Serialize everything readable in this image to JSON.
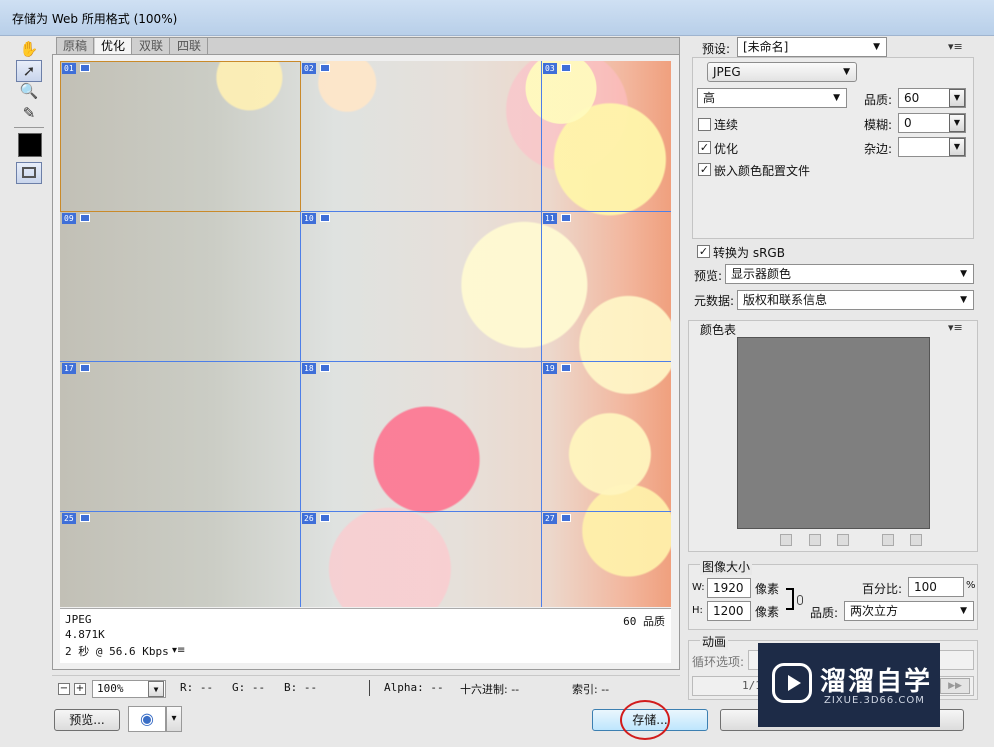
{
  "window": {
    "title": "存储为 Web 所用格式 (100%)"
  },
  "tools": [
    {
      "name": "hand-tool-icon",
      "glyph": "✋"
    },
    {
      "name": "slice-select-tool-icon",
      "glyph": "➚"
    },
    {
      "name": "zoom-tool-icon",
      "glyph": "🔍"
    },
    {
      "name": "eyedropper-tool-icon",
      "glyph": "✎"
    }
  ],
  "tabs": [
    "原稿",
    "优化",
    "双联",
    "四联"
  ],
  "active_tab": "优化",
  "slices": [
    "01",
    "02",
    "03",
    "09",
    "10",
    "11",
    "17",
    "18",
    "19",
    "25",
    "26",
    "27"
  ],
  "image_info": {
    "format": "JPEG",
    "size": "4.871K",
    "time": "2 秒 @ 56.6 Kbps",
    "quality": "60 品质",
    "menu": "▾≡"
  },
  "status_bar": {
    "zoom_minus": "−",
    "zoom_plus": "+",
    "zoom": "100%",
    "r": "R: --",
    "g": "G: --",
    "b": "B: --",
    "alpha": "Alpha: --",
    "hex": "十六进制: --",
    "index": "索引: --"
  },
  "buttons": {
    "preview": "预览...",
    "save": "存储...",
    "browser_icon": "◉",
    "dropdown": "▾"
  },
  "settings": {
    "preset_label": "预设:",
    "preset_value": "[未命名]",
    "menu_icon": "▾≡",
    "format": "JPEG",
    "quality_preset": "高",
    "quality_label": "品质:",
    "quality_value": "60",
    "progressive_label": "连续",
    "progressive_checked": false,
    "blur_label": "模糊:",
    "blur_value": "0",
    "optimized_label": "优化",
    "optimized_checked": true,
    "matte_label": "杂边:",
    "matte_value": "",
    "embed_profile_label": "嵌入颜色配置文件",
    "embed_profile_checked": true,
    "convert_srgb_label": "转换为 sRGB",
    "convert_srgb_checked": true,
    "preview_label": "预览:",
    "preview_value": "显示器颜色",
    "metadata_label": "元数据:",
    "metadata_value": "版权和联系信息",
    "check_mark": "✓",
    "arrow": "▼"
  },
  "color_table": {
    "title": "颜色表",
    "swatch_color": "#7f7f7f"
  },
  "image_size": {
    "title": "图像大小",
    "w_label": "W:",
    "w_value": "1920",
    "h_label": "H:",
    "h_value": "1200",
    "unit": "像素",
    "percent_label": "百分比:",
    "percent_value": "100",
    "percent_unit": "%",
    "quality_label": "品质:",
    "quality_value": "两次立方"
  },
  "animation": {
    "title": "动画",
    "loop_label": "循环选项:",
    "frame_counter": "1/1"
  },
  "watermark": {
    "title": "溜溜自学",
    "url": "ZIXUE.3D66.COM"
  }
}
